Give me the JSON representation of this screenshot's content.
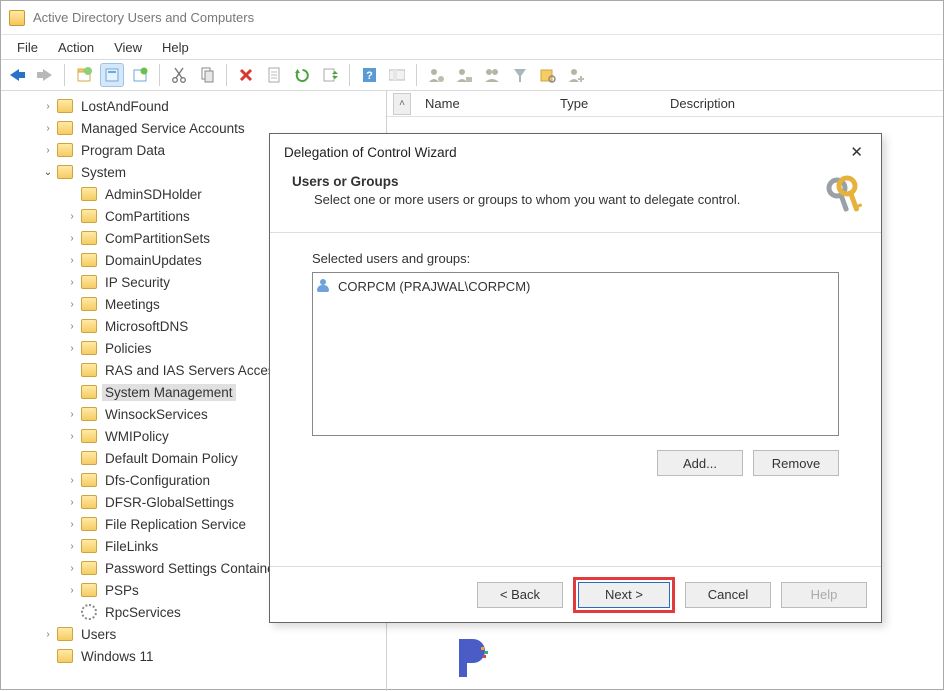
{
  "window": {
    "title": "Active Directory Users and Computers"
  },
  "menu": {
    "file": "File",
    "action": "Action",
    "view": "View",
    "help": "Help"
  },
  "list": {
    "col_name": "Name",
    "col_type": "Type",
    "col_desc": "Description"
  },
  "tree": {
    "n0": "LostAndFound",
    "n1": "Managed Service Accounts",
    "n2": "Program Data",
    "n3": "System",
    "n4": "AdminSDHolder",
    "n5": "ComPartitions",
    "n6": "ComPartitionSets",
    "n7": "DomainUpdates",
    "n8": "IP Security",
    "n9": "Meetings",
    "n10": "MicrosoftDNS",
    "n11": "Policies",
    "n12": "RAS and IAS Servers Access",
    "n13": "System Management",
    "n14": "WinsockServices",
    "n15": "WMIPolicy",
    "n16": "Default Domain Policy",
    "n17": "Dfs-Configuration",
    "n18": "DFSR-GlobalSettings",
    "n19": "File Replication Service",
    "n20": "FileLinks",
    "n21": "Password Settings Container",
    "n22": "PSPs",
    "n23": "RpcServices",
    "n24": "Users",
    "n25": "Windows 11"
  },
  "dialog": {
    "title": "Delegation of Control Wizard",
    "heading": "Users or Groups",
    "subheading": "Select one or more users or groups to whom you want to delegate control.",
    "list_label": "Selected users and groups:",
    "item0": "CORPCM (PRAJWAL\\CORPCM)",
    "add": "Add...",
    "remove": "Remove",
    "back": "< Back",
    "next": "Next >",
    "cancel": "Cancel",
    "help": "Help"
  }
}
